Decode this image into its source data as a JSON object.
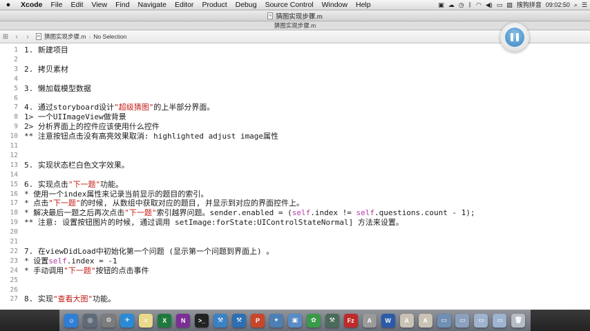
{
  "menubar": {
    "apple_symbol": "",
    "items": [
      "Xcode",
      "File",
      "Edit",
      "View",
      "Find",
      "Navigate",
      "Editor",
      "Product",
      "Debug",
      "Source Control",
      "Window",
      "Help"
    ],
    "input_method": "搜狗拼音",
    "clock": "09:02:50"
  },
  "window": {
    "title": "猜图实现步骤.m",
    "tab_title": "猜图实现步骤.m"
  },
  "jumpbar": {
    "file": "猜图实现步骤.m",
    "selection": "No Selection"
  },
  "code_lines": [
    {
      "n": "1",
      "segments": [
        {
          "t": "1. 新建项目",
          "c": "n"
        }
      ]
    },
    {
      "n": "2",
      "segments": []
    },
    {
      "n": "3",
      "segments": [
        {
          "t": "2. 拷贝素材",
          "c": "n"
        }
      ]
    },
    {
      "n": "4",
      "segments": []
    },
    {
      "n": "5",
      "segments": [
        {
          "t": "3. 懒加载模型数据",
          "c": "n"
        }
      ]
    },
    {
      "n": "6",
      "segments": []
    },
    {
      "n": "7",
      "segments": [
        {
          "t": "4. 通过storyboard设计",
          "c": "n"
        },
        {
          "t": "\"超级猜图\"",
          "c": "s"
        },
        {
          "t": "的上半部分界面。",
          "c": "n"
        }
      ]
    },
    {
      "n": "8",
      "segments": [
        {
          "t": "1> 一个UIImageView做背景",
          "c": "n"
        }
      ]
    },
    {
      "n": "9",
      "segments": [
        {
          "t": "2> 分析界面上的控件应该使用什么控件",
          "c": "n"
        }
      ]
    },
    {
      "n": "10",
      "segments": [
        {
          "t": "** 注意按钮点击没有高亮效果取消: highlighted adjust image属性",
          "c": "n"
        }
      ]
    },
    {
      "n": "11",
      "segments": []
    },
    {
      "n": "12",
      "segments": []
    },
    {
      "n": "13",
      "segments": [
        {
          "t": "5. 实现状态栏白色文字效果。",
          "c": "n"
        }
      ]
    },
    {
      "n": "14",
      "segments": []
    },
    {
      "n": "15",
      "segments": [
        {
          "t": "6. 实现点击",
          "c": "n"
        },
        {
          "t": "\"下一题\"",
          "c": "s"
        },
        {
          "t": "功能。",
          "c": "n"
        }
      ]
    },
    {
      "n": "16",
      "segments": [
        {
          "t": "* 使用一个index属性来记录当前显示的题目的索引。",
          "c": "n"
        }
      ]
    },
    {
      "n": "17",
      "segments": [
        {
          "t": "* 点击",
          "c": "n"
        },
        {
          "t": "\"下一题\"",
          "c": "s"
        },
        {
          "t": "的时候, 从数组中获取对应的题目, 并显示到对应的界面控件上。",
          "c": "n"
        }
      ]
    },
    {
      "n": "18",
      "segments": [
        {
          "t": "* 解决最后一题之后再次点击",
          "c": "n"
        },
        {
          "t": "\"下一题\"",
          "c": "s"
        },
        {
          "t": "索引越界问题。sender.enabled = (",
          "c": "n"
        },
        {
          "t": "self",
          "c": "k"
        },
        {
          "t": ".index != ",
          "c": "n"
        },
        {
          "t": "self",
          "c": "k"
        },
        {
          "t": ".questions.count - 1);",
          "c": "n"
        }
      ]
    },
    {
      "n": "19",
      "segments": [
        {
          "t": "** 注意: 设置按钮图片的时候, 通过调用 setImage:forState:UIControlStateNormal] 方法来设置。",
          "c": "n"
        }
      ]
    },
    {
      "n": "20",
      "segments": []
    },
    {
      "n": "21",
      "segments": []
    },
    {
      "n": "22",
      "segments": [
        {
          "t": "7. 在viewDidLoad中初始化第一个问题 (显示第一个问题到界面上) 。",
          "c": "n"
        }
      ]
    },
    {
      "n": "23",
      "segments": [
        {
          "t": "* 设置",
          "c": "n"
        },
        {
          "t": "self",
          "c": "k"
        },
        {
          "t": ".index = -1",
          "c": "n"
        }
      ]
    },
    {
      "n": "24",
      "segments": [
        {
          "t": "* 手动调用",
          "c": "n"
        },
        {
          "t": "\"下一题\"",
          "c": "s"
        },
        {
          "t": "按钮的点击事件",
          "c": "n"
        }
      ]
    },
    {
      "n": "25",
      "segments": []
    },
    {
      "n": "26",
      "segments": []
    },
    {
      "n": "27",
      "segments": [
        {
          "t": "8. 实现",
          "c": "n"
        },
        {
          "t": "\"查看大图\"",
          "c": "s"
        },
        {
          "t": "功能。",
          "c": "n"
        }
      ]
    }
  ],
  "dock_icons": [
    {
      "name": "finder",
      "color": "#2f7fd6",
      "glyph": "☺"
    },
    {
      "name": "launchpad",
      "color": "#606a78",
      "glyph": "◎"
    },
    {
      "name": "system-preferences",
      "color": "#7c7c7c",
      "glyph": "⚙"
    },
    {
      "name": "safari",
      "color": "#2a8ad6",
      "glyph": "✈"
    },
    {
      "name": "notes",
      "color": "#e9d98a",
      "glyph": "≡"
    },
    {
      "name": "excel",
      "color": "#1e7a3c",
      "glyph": "X"
    },
    {
      "name": "onenote",
      "color": "#7b2f94",
      "glyph": "N"
    },
    {
      "name": "terminal",
      "color": "#222222",
      "glyph": ">_"
    },
    {
      "name": "xcode",
      "color": "#3b82c4",
      "glyph": "⚒"
    },
    {
      "name": "xcode-2",
      "color": "#2c6fb3",
      "glyph": "⚒"
    },
    {
      "name": "powerpoint",
      "color": "#c8462b",
      "glyph": "P"
    },
    {
      "name": "instruments",
      "color": "#4d7fb5",
      "glyph": "✦"
    },
    {
      "name": "preview",
      "color": "#5a8bc4",
      "glyph": "▣"
    },
    {
      "name": "photos",
      "color": "#3a9a4a",
      "glyph": "✿"
    },
    {
      "name": "tools",
      "color": "#4a6b5a",
      "glyph": "⚒"
    },
    {
      "name": "filezilla",
      "color": "#bf2a2a",
      "glyph": "Fz"
    },
    {
      "name": "app-store",
      "color": "#9a9a9a",
      "glyph": "A"
    },
    {
      "name": "word",
      "color": "#2a5aa8",
      "glyph": "W"
    },
    {
      "name": "acrobat",
      "color": "#c9c2b5",
      "glyph": "A"
    },
    {
      "name": "preview-2",
      "color": "#c9c2b5",
      "glyph": "A"
    },
    {
      "name": "downloads",
      "color": "#6f8fb3",
      "glyph": "▭"
    },
    {
      "name": "documents",
      "color": "#8aa0bd",
      "glyph": "▭"
    },
    {
      "name": "folder",
      "color": "#9db3cf",
      "glyph": "▭"
    },
    {
      "name": "folder-2",
      "color": "#9db3cf",
      "glyph": "▭"
    },
    {
      "name": "trash",
      "color": "#b5bcc4",
      "glyph": "🗑"
    }
  ]
}
